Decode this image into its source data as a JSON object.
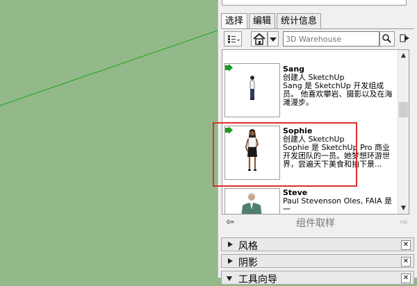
{
  "tabs": [
    {
      "label": "选择",
      "active": true
    },
    {
      "label": "编辑",
      "active": false
    },
    {
      "label": "统计信息",
      "active": false
    }
  ],
  "search": {
    "placeholder": "3D Warehouse"
  },
  "components": [
    {
      "name": "Sang",
      "author": "创建人 SketchUp",
      "description": "Sang 是 SketchUp 开发组成员。 他喜欢攀岩、摄影以及在海滩漫步。"
    },
    {
      "name": "Sophie",
      "author": "创建人 SketchUp",
      "description": "Sophie 是 SketchUp Pro 商业开发团队的一员。她梦想环游世界，尝遍天下美食和拍下景..."
    },
    {
      "name": "Steve",
      "author": "Paul Stevenson Oles, FAIA 是一",
      "description": ""
    }
  ],
  "nav": {
    "title": "组件取样"
  },
  "sections": [
    {
      "title": "风格",
      "expanded": false
    },
    {
      "title": "阴影",
      "expanded": false
    },
    {
      "title": "工具向导",
      "expanded": true
    }
  ],
  "colors": {
    "viewport": "#93b98a",
    "axis_line": "#1aa71a",
    "highlight": "#d9302c",
    "go_arrow": "#1f9a1f"
  },
  "icons": [
    "view-options-icon",
    "home-icon",
    "search-icon",
    "open-window-icon",
    "back-arrow-icon",
    "forward-arrow-icon",
    "close-icon"
  ]
}
